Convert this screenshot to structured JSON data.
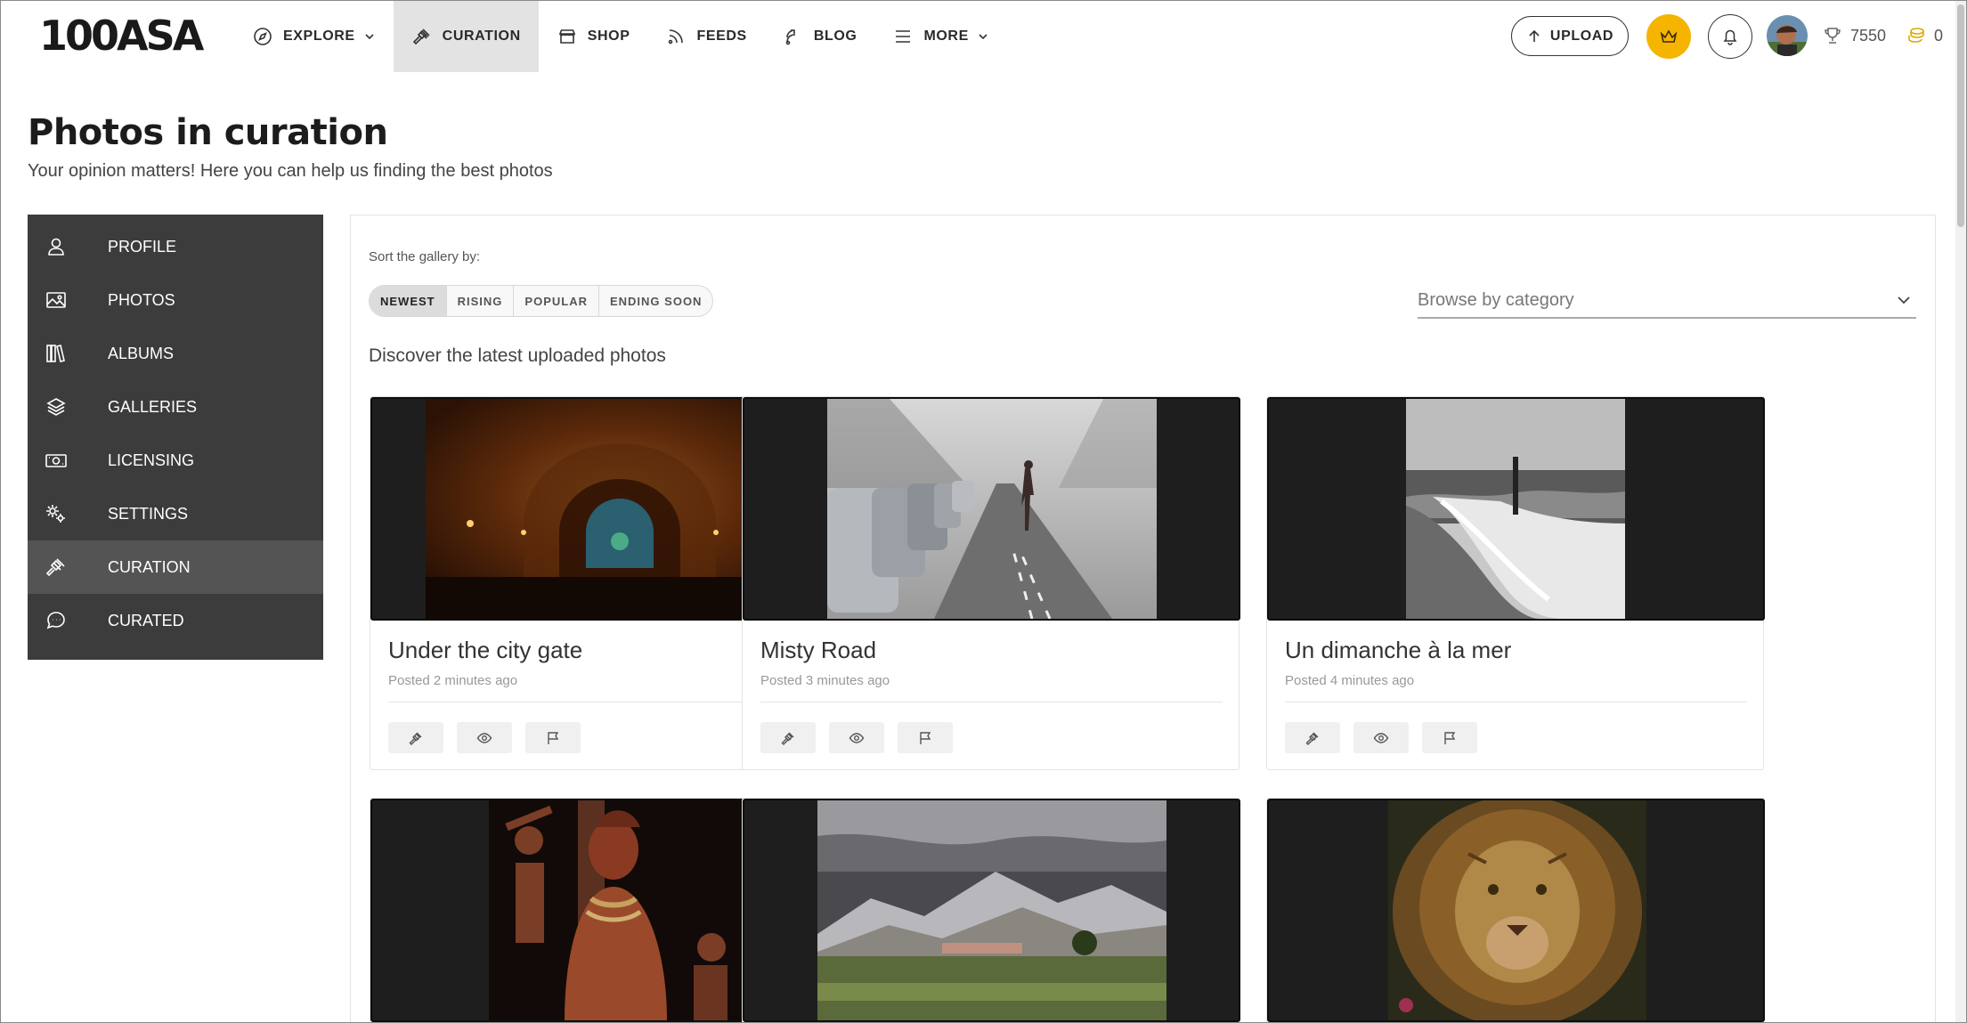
{
  "logo": "100ASA",
  "nav": {
    "explore": "EXPLORE",
    "curation": "CURATION",
    "shop": "SHOP",
    "feeds": "FEEDS",
    "blog": "BLOG",
    "more": "MORE"
  },
  "header": {
    "upload_label": "UPLOAD",
    "trophy_points": "7550",
    "coins": "0",
    "accent_color": "#f5b400"
  },
  "page": {
    "title": "Photos in curation",
    "subtitle": "Your opinion matters! Here you can help us finding the best photos"
  },
  "sidebar": {
    "items": [
      {
        "label": "PROFILE",
        "icon": "user-icon"
      },
      {
        "label": "PHOTOS",
        "icon": "image-icon"
      },
      {
        "label": "ALBUMS",
        "icon": "books-icon"
      },
      {
        "label": "GALLERIES",
        "icon": "layers-icon"
      },
      {
        "label": "LICENSING",
        "icon": "money-icon"
      },
      {
        "label": "SETTINGS",
        "icon": "gears-icon"
      },
      {
        "label": "CURATION",
        "icon": "gavel-icon",
        "active": true
      },
      {
        "label": "CURATED",
        "icon": "chat-icon"
      }
    ]
  },
  "gallery": {
    "sort_label": "Sort the gallery by:",
    "sort_options": [
      "NEWEST",
      "RISING",
      "POPULAR",
      "ENDING SOON"
    ],
    "sort_active": "NEWEST",
    "category_placeholder": "Browse by category",
    "discover_text": "Discover the latest uploaded photos",
    "photos": [
      {
        "title": "Under the city gate",
        "posted": "Posted 2 minutes ago",
        "subject": "tunnel"
      },
      {
        "title": "Misty Road",
        "posted": "Posted 3 minutes ago",
        "subject": "misty-road"
      },
      {
        "title": "Un dimanche à la mer",
        "posted": "Posted 4 minutes ago",
        "subject": "sea-shore"
      },
      {
        "title": "",
        "posted": "",
        "subject": "tribal-woman"
      },
      {
        "title": "",
        "posted": "",
        "subject": "mountain-landscape"
      },
      {
        "title": "",
        "posted": "",
        "subject": "lion"
      }
    ]
  }
}
